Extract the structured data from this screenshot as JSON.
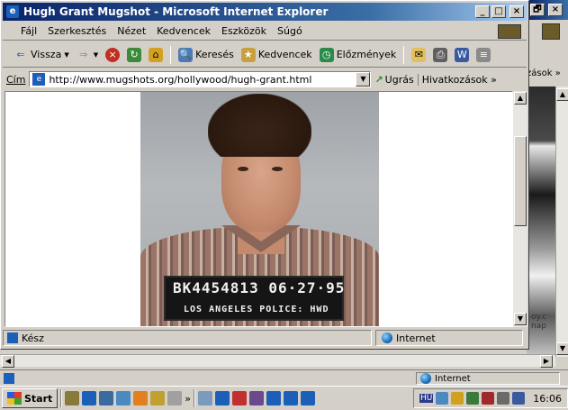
{
  "window": {
    "title": "Hugh Grant Mugshot - Microsoft Internet Explorer",
    "min_label": "_",
    "max_label": "□",
    "close_label": "×"
  },
  "menu": {
    "items": [
      "Fájl",
      "Szerkesztés",
      "Nézet",
      "Kedvencek",
      "Eszközök",
      "Súgó"
    ]
  },
  "toolbar": {
    "back_label": "Vissza",
    "forward_glyph": "⇒",
    "search_label": "Keresés",
    "favorites_label": "Kedvencek",
    "history_label": "Előzmények"
  },
  "address": {
    "label": "Cím",
    "url": "http://www.mugshots.org/hollywood/hugh-grant.html",
    "go_label": "Ugrás",
    "links_label": "Hivatkozások",
    "links_overflow": "»"
  },
  "mugshot": {
    "placard_top": "BK4454813 06·27·95",
    "placard_bottom": "LOS ANGELES POLICE: HWD"
  },
  "statusbar": {
    "text": "Kész",
    "zone": "Internet"
  },
  "background_window": {
    "links_text": "zások »",
    "close_label": "×",
    "restore_label": "🗗",
    "content_text": "oy.c nap",
    "status_zone": "Internet"
  },
  "taskbar": {
    "start_label": "Start",
    "overflow": "»",
    "clock": "16:06",
    "tray_label": "HU"
  },
  "colors": {
    "title_active": "#0a246a",
    "chrome": "#d4d0c8",
    "placard_bg": "#151515"
  },
  "icons": [
    "ie-logo-icon",
    "back-icon",
    "forward-icon",
    "stop-icon",
    "refresh-icon",
    "home-icon",
    "search-icon",
    "favorites-icon",
    "history-icon",
    "mail-icon",
    "print-icon",
    "edit-icon",
    "discuss-icon",
    "go-icon",
    "globe-icon",
    "start-logo-icon"
  ]
}
